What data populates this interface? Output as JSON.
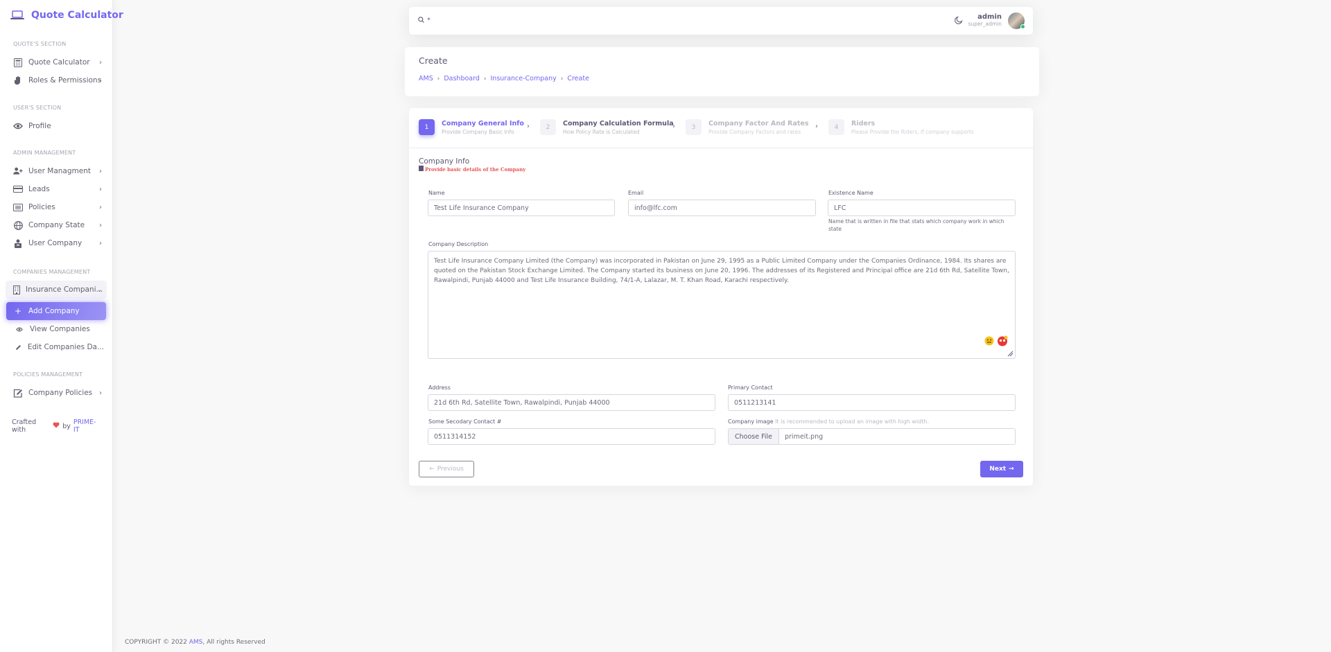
{
  "app": {
    "title": "Quote Calculator"
  },
  "sidebar": {
    "sections": [
      {
        "heading": "QUOTE'S SECTION",
        "items": [
          {
            "label": "Quote Calculator",
            "icon": "calculator-icon"
          },
          {
            "label": "Roles & Permissions",
            "icon": "hand-icon"
          }
        ]
      },
      {
        "heading": "USER'S SECTION",
        "items": [
          {
            "label": "Profile",
            "icon": "eye-icon"
          }
        ]
      },
      {
        "heading": "ADMIN MANAGEMENT",
        "items": [
          {
            "label": "User Managment",
            "icon": "user-plus-icon"
          },
          {
            "label": "Leads",
            "icon": "card-icon"
          },
          {
            "label": "Policies",
            "icon": "list-icon"
          },
          {
            "label": "Company State",
            "icon": "globe-icon"
          },
          {
            "label": "User Company",
            "icon": "briefcase-icon"
          }
        ]
      },
      {
        "heading": "COMPANIES MANAGEMENT",
        "items": [
          {
            "label": "Insurance Compani...",
            "icon": "building-icon"
          },
          {
            "label": "Add Company",
            "icon": "plus-icon"
          },
          {
            "label": "View Companies",
            "icon": "eye-icon"
          },
          {
            "label": "Edit Companies Da...",
            "icon": "pencil-icon"
          }
        ]
      },
      {
        "heading": "POLICIES MANAGEMENT",
        "items": [
          {
            "label": "Company Policies",
            "icon": "edit-icon"
          }
        ]
      }
    ],
    "crafted": {
      "prefix": "Crafted with",
      "by": "by",
      "brand": "PRIME-IT"
    }
  },
  "topbar": {
    "search_value": "*",
    "user": {
      "name": "admin",
      "role": "super_admin"
    }
  },
  "header": {
    "title": "Create",
    "breadcrumb": [
      "AMS",
      "Dashboard",
      "Insurance-Company",
      "Create"
    ]
  },
  "wizard": {
    "steps": [
      {
        "num": "1",
        "title": "Company General Info",
        "subtitle": "Provide Company Basic Info"
      },
      {
        "num": "2",
        "title": "Company Calculation Formula",
        "subtitle": "How Policy Rate is Calculated"
      },
      {
        "num": "3",
        "title": "Company Factor And Rates",
        "subtitle": "Provide Company Factors and rates"
      },
      {
        "num": "4",
        "title": "Riders",
        "subtitle": "Please Provide the Riders, if company supports"
      }
    ],
    "section_title": "Company Info",
    "section_subtitle": "Provide basic details of the Company",
    "fields": {
      "name": {
        "label": "Name",
        "value": "Test Life Insurance Company"
      },
      "email": {
        "label": "Email",
        "value": "info@lfc.com"
      },
      "existence": {
        "label": "Existence Name",
        "value": "LFC",
        "help": "Name that is written in file that stats which company work in which state"
      },
      "description": {
        "label": "Company Description",
        "value": "Test Life Insurance Company Limited (the Company) was incorporated in Pakistan on June 29, 1995 as a Public Limited Company under the Companies Ordinance, 1984. Its shares are quoted on the Pakistan Stock Exchange Limited. The Company started its business on June 20, 1996. The addresses of its Registered and Principal office are 21d 6th Rd, Satellite Town, Rawalpindi, Punjab 44000 and Test Life Insurance Building, 74/1-A, Lalazar, M. T. Khan Road, Karachi respectively."
      },
      "address": {
        "label": "Address",
        "value": "21d 6th Rd, Satellite Town, Rawalpindi, Punjab 44000"
      },
      "primary_contact": {
        "label": "Primary Contact",
        "value": "0511213141"
      },
      "secondary_contact": {
        "label": "Some Secodary Contact #",
        "value": "0511314152"
      },
      "image": {
        "label": "Company image",
        "hint": "It is recommended to upload an image with high width.",
        "button": "Choose File",
        "file": "primeit.png"
      }
    },
    "buttons": {
      "previous": "Previous",
      "next": "Next"
    }
  },
  "footer": {
    "prefix": "COPYRIGHT © 2022",
    "brand": "AMS",
    "suffix": ", All rights Reserved"
  },
  "colors": {
    "primary": "#7367f0",
    "danger": "#ea5455",
    "success": "#28c76f"
  }
}
